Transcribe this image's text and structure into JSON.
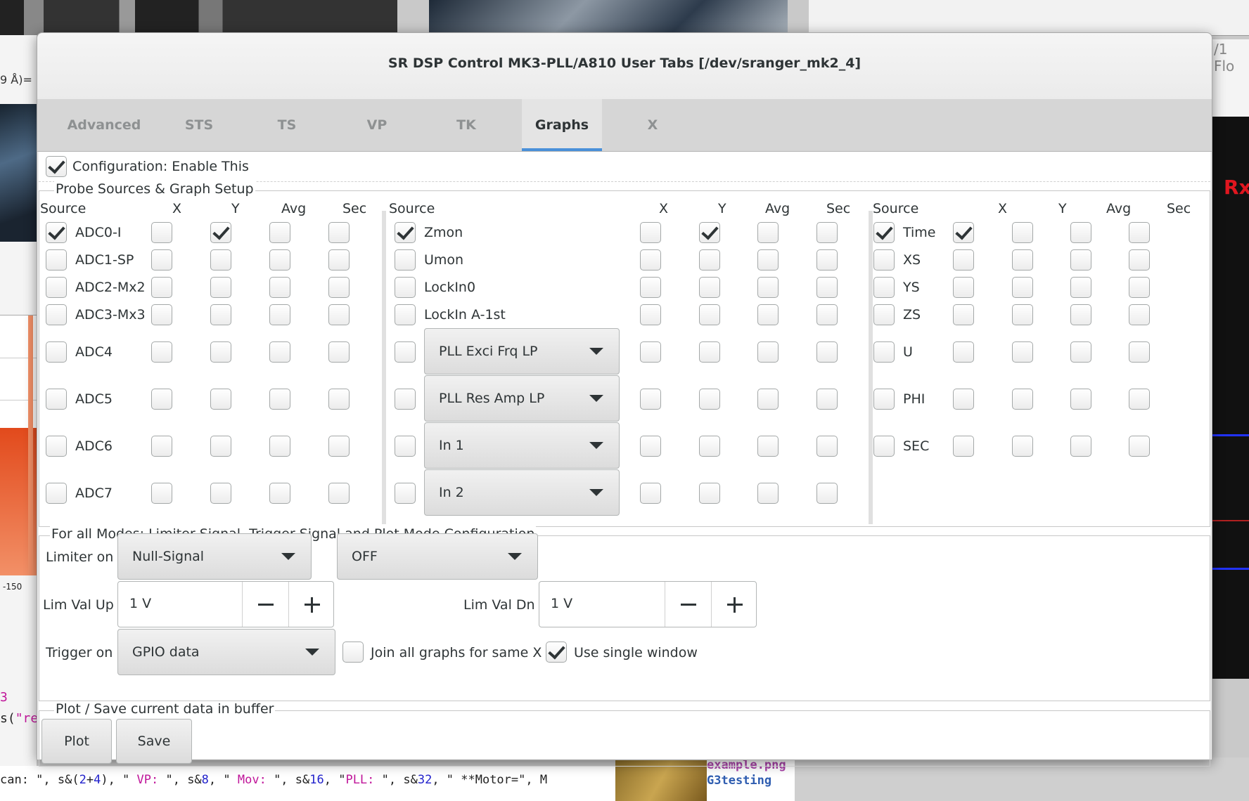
{
  "window": {
    "title": "SR DSP Control MK3-PLL/A810 User Tabs [/dev/sranger_mk2_4]"
  },
  "tabs": [
    {
      "label": "Advanced",
      "active": false
    },
    {
      "label": "STS",
      "active": false
    },
    {
      "label": "TS",
      "active": false
    },
    {
      "label": "VP",
      "active": false
    },
    {
      "label": "TK",
      "active": false
    },
    {
      "label": "Graphs",
      "active": true
    },
    {
      "label": "X",
      "active": false
    }
  ],
  "config": {
    "label": "Configuration: Enable This",
    "checked": true
  },
  "probe": {
    "frame_title": "Probe Sources & Graph Setup",
    "headers": {
      "source": "Source",
      "x": "X",
      "y": "Y",
      "avg": "Avg",
      "sec": "Sec"
    },
    "col1": [
      {
        "label": "ADC0-I",
        "src": true,
        "x": false,
        "y": true,
        "avg": false,
        "sec": false
      },
      {
        "label": "ADC1-SP",
        "src": false,
        "x": false,
        "y": false,
        "avg": false,
        "sec": false
      },
      {
        "label": "ADC2-Mx2",
        "src": false,
        "x": false,
        "y": false,
        "avg": false,
        "sec": false
      },
      {
        "label": "ADC3-Mx3",
        "src": false,
        "x": false,
        "y": false,
        "avg": false,
        "sec": false
      },
      {
        "label": "ADC4",
        "src": false,
        "x": false,
        "y": false,
        "avg": false,
        "sec": false
      },
      {
        "label": "ADC5",
        "src": false,
        "x": false,
        "y": false,
        "avg": false,
        "sec": false
      },
      {
        "label": "ADC6",
        "src": false,
        "x": false,
        "y": false,
        "avg": false,
        "sec": false
      },
      {
        "label": "ADC7",
        "src": false,
        "x": false,
        "y": false,
        "avg": false,
        "sec": false
      }
    ],
    "col2": [
      {
        "label": "Zmon",
        "src": true,
        "x": false,
        "y": true,
        "avg": false,
        "sec": false
      },
      {
        "label": "Umon",
        "src": false,
        "x": false,
        "y": false,
        "avg": false,
        "sec": false
      },
      {
        "label": "LockIn0",
        "src": false,
        "x": false,
        "y": false,
        "avg": false,
        "sec": false
      },
      {
        "label": "LockIn A-1st",
        "src": false,
        "x": false,
        "y": false,
        "avg": false,
        "sec": false
      },
      {
        "combo": "PLL Exci Frq LP",
        "src": false,
        "x": false,
        "y": false,
        "avg": false,
        "sec": false
      },
      {
        "combo": "PLL Res Amp LP",
        "src": false,
        "x": false,
        "y": false,
        "avg": false,
        "sec": false
      },
      {
        "combo": "In 1",
        "src": false,
        "x": false,
        "y": false,
        "avg": false,
        "sec": false
      },
      {
        "combo": "In 2",
        "src": false,
        "x": false,
        "y": false,
        "avg": false,
        "sec": false
      }
    ],
    "col3": [
      {
        "label": "Time",
        "src": true,
        "x": true,
        "y": false,
        "avg": false,
        "sec": false
      },
      {
        "label": "XS",
        "src": false,
        "x": false,
        "y": false,
        "avg": false,
        "sec": false
      },
      {
        "label": "YS",
        "src": false,
        "x": false,
        "y": false,
        "avg": false,
        "sec": false
      },
      {
        "label": "ZS",
        "src": false,
        "x": false,
        "y": false,
        "avg": false,
        "sec": false
      },
      {
        "label": "U",
        "src": false,
        "x": false,
        "y": false,
        "avg": false,
        "sec": false
      },
      {
        "label": "PHI",
        "src": false,
        "x": false,
        "y": false,
        "avg": false,
        "sec": false
      },
      {
        "label": "SEC",
        "src": false,
        "x": false,
        "y": false,
        "avg": false,
        "sec": false
      }
    ]
  },
  "modes": {
    "frame_title": "For all Modes: Limiter Signal, Trigger Signal and Plot Mode Configuration",
    "limiter_label": "Limiter on",
    "limiter_signal": "Null-Signal",
    "limiter_state": "OFF",
    "lim_up_label": "Lim Val Up",
    "lim_up_value": "1 V",
    "lim_dn_label": "Lim Val Dn",
    "lim_dn_value": "1 V",
    "trigger_label": "Trigger on",
    "trigger_signal": "GPIO data",
    "join_label": "Join all graphs for same X",
    "join_checked": false,
    "single_label": "Use single window",
    "single_checked": true
  },
  "plot_save": {
    "frame_title": "Plot / Save current data in buffer",
    "plot_label": "Plot",
    "save_label": "Save"
  },
  "background": {
    "left_label": "9 Å)=",
    "left_tick": "-150",
    "right_label": "Rx",
    "right_top": "/1 Flo",
    "files": [
      "example.png",
      "G3testing"
    ]
  }
}
